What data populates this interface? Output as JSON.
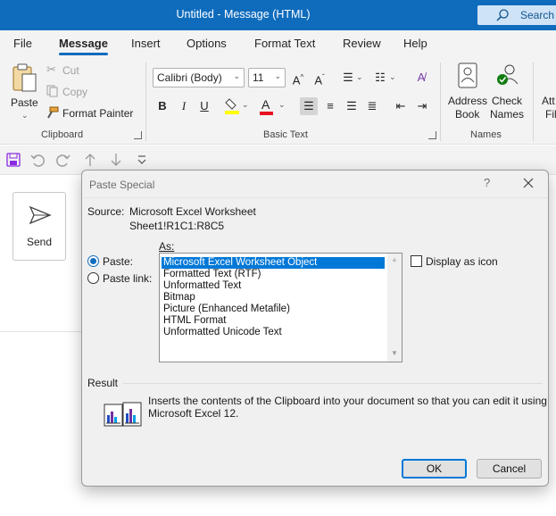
{
  "window": {
    "title": "Untitled  -  Message (HTML)"
  },
  "search": {
    "label": "Search"
  },
  "tabs": [
    {
      "label": "File"
    },
    {
      "label": "Message"
    },
    {
      "label": "Insert"
    },
    {
      "label": "Options"
    },
    {
      "label": "Format Text"
    },
    {
      "label": "Review"
    },
    {
      "label": "Help"
    }
  ],
  "ribbon": {
    "clipboard": {
      "paste_label": "Paste",
      "cut_label": "Cut",
      "copy_label": "Copy",
      "format_painter_label": "Format Painter",
      "group_label": "Clipboard"
    },
    "basic_text": {
      "font_name": "Calibri (Body)",
      "font_size": "11",
      "group_label": "Basic Text",
      "bold": "B",
      "italic": "I",
      "underline": "U"
    },
    "names": {
      "address_book_line1": "Address",
      "address_book_line2": "Book",
      "check_names_line1": "Check",
      "check_names_line2": "Names",
      "group_label": "Names"
    },
    "attach": {
      "line1": "Att",
      "line2": "Fil"
    }
  },
  "message": {
    "send_label": "Send"
  },
  "dialog": {
    "title": "Paste Special",
    "help": "?",
    "source_label": "Source:",
    "source_value": "Microsoft Excel Worksheet",
    "source_range": "Sheet1!R1C1:R8C5",
    "as_label": "As:",
    "paste_radio": "Paste:",
    "paste_link_radio": "Paste link:",
    "formats": [
      "Microsoft Excel Worksheet Object",
      "Formatted Text (RTF)",
      "Unformatted Text",
      "Bitmap",
      "Picture (Enhanced Metafile)",
      "HTML Format",
      "Unformatted Unicode Text"
    ],
    "display_as_icon": "Display as icon",
    "result_label": "Result",
    "result_line1": "Inserts the contents of the Clipboard into your document so that you can edit it using",
    "result_line2": "Microsoft Excel 12.",
    "ok": "OK",
    "cancel": "Cancel"
  },
  "colors": {
    "accent": "#0f6cbd",
    "highlight": "#ffff00",
    "font_color": "#e81123",
    "selection": "#0078d7"
  }
}
